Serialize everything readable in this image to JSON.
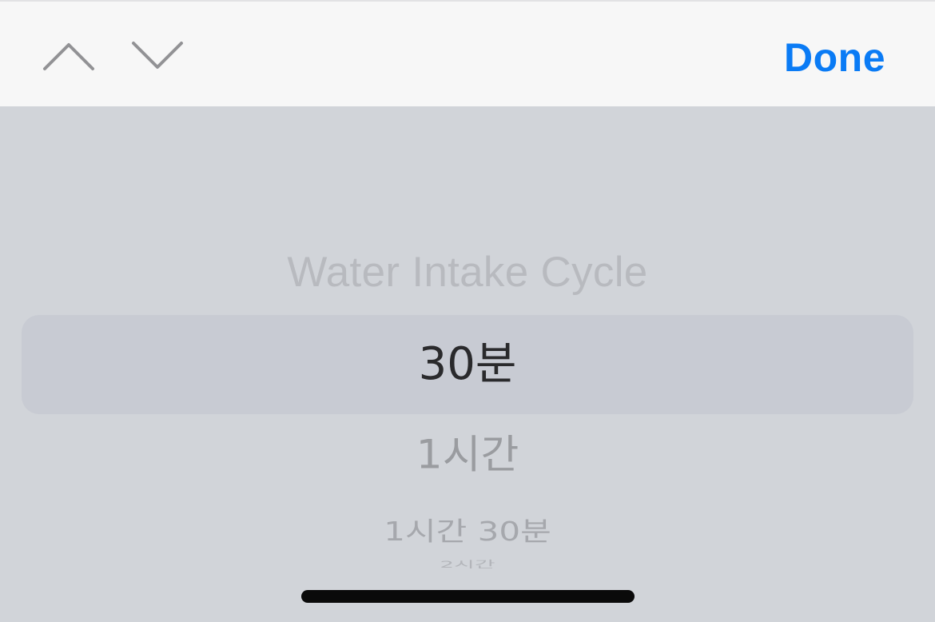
{
  "toolbar": {
    "prev_icon": "chevron-up-icon",
    "next_icon": "chevron-down-icon",
    "done_label": "Done",
    "done_color": "#0a7bf5",
    "icon_color": "#929295"
  },
  "picker": {
    "title": "Water Intake Cycle",
    "selected_index": 0,
    "options": [
      {
        "label": "30분"
      },
      {
        "label": "1시간"
      },
      {
        "label": "1시간 30분"
      },
      {
        "label": "2시간"
      }
    ]
  }
}
